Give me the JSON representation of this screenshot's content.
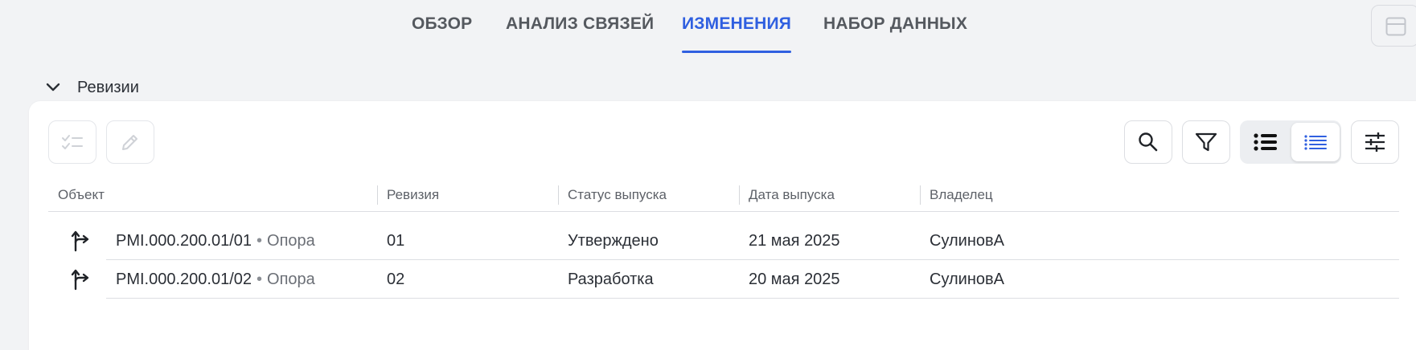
{
  "tabs": [
    {
      "label": "ОБЗОР",
      "active": false
    },
    {
      "label": "АНАЛИЗ СВЯЗЕЙ",
      "active": false
    },
    {
      "label": "ИЗМЕНЕНИЯ",
      "active": true
    },
    {
      "label": "НАБОР ДАННЫХ",
      "active": false
    }
  ],
  "section": {
    "title": "Ревизии",
    "expanded": true
  },
  "toolbar": {
    "left_icons": [
      "checklist-icon",
      "pencil-icon"
    ],
    "right_icons": [
      "search-icon",
      "filter-icon",
      "list-view-icon",
      "compact-list-icon",
      "sliders-icon"
    ]
  },
  "table": {
    "columns": [
      "Объект",
      "Ревизия",
      "Статус выпуска",
      "Дата выпуска",
      "Владелец"
    ],
    "rows": [
      {
        "object": "PMI.000.200.01/01",
        "type": "Опора",
        "revision": "01",
        "status": "Утверждено",
        "date": "21 мая 2025",
        "owner": "СулиновА"
      },
      {
        "object": "PMI.000.200.01/02",
        "type": "Опора",
        "revision": "02",
        "status": "Разработка",
        "date": "20 мая 2025",
        "owner": "СулиновА"
      }
    ]
  },
  "colors": {
    "accent": "#2f5fe0",
    "background": "#f2f3f5",
    "card": "#ffffff"
  }
}
